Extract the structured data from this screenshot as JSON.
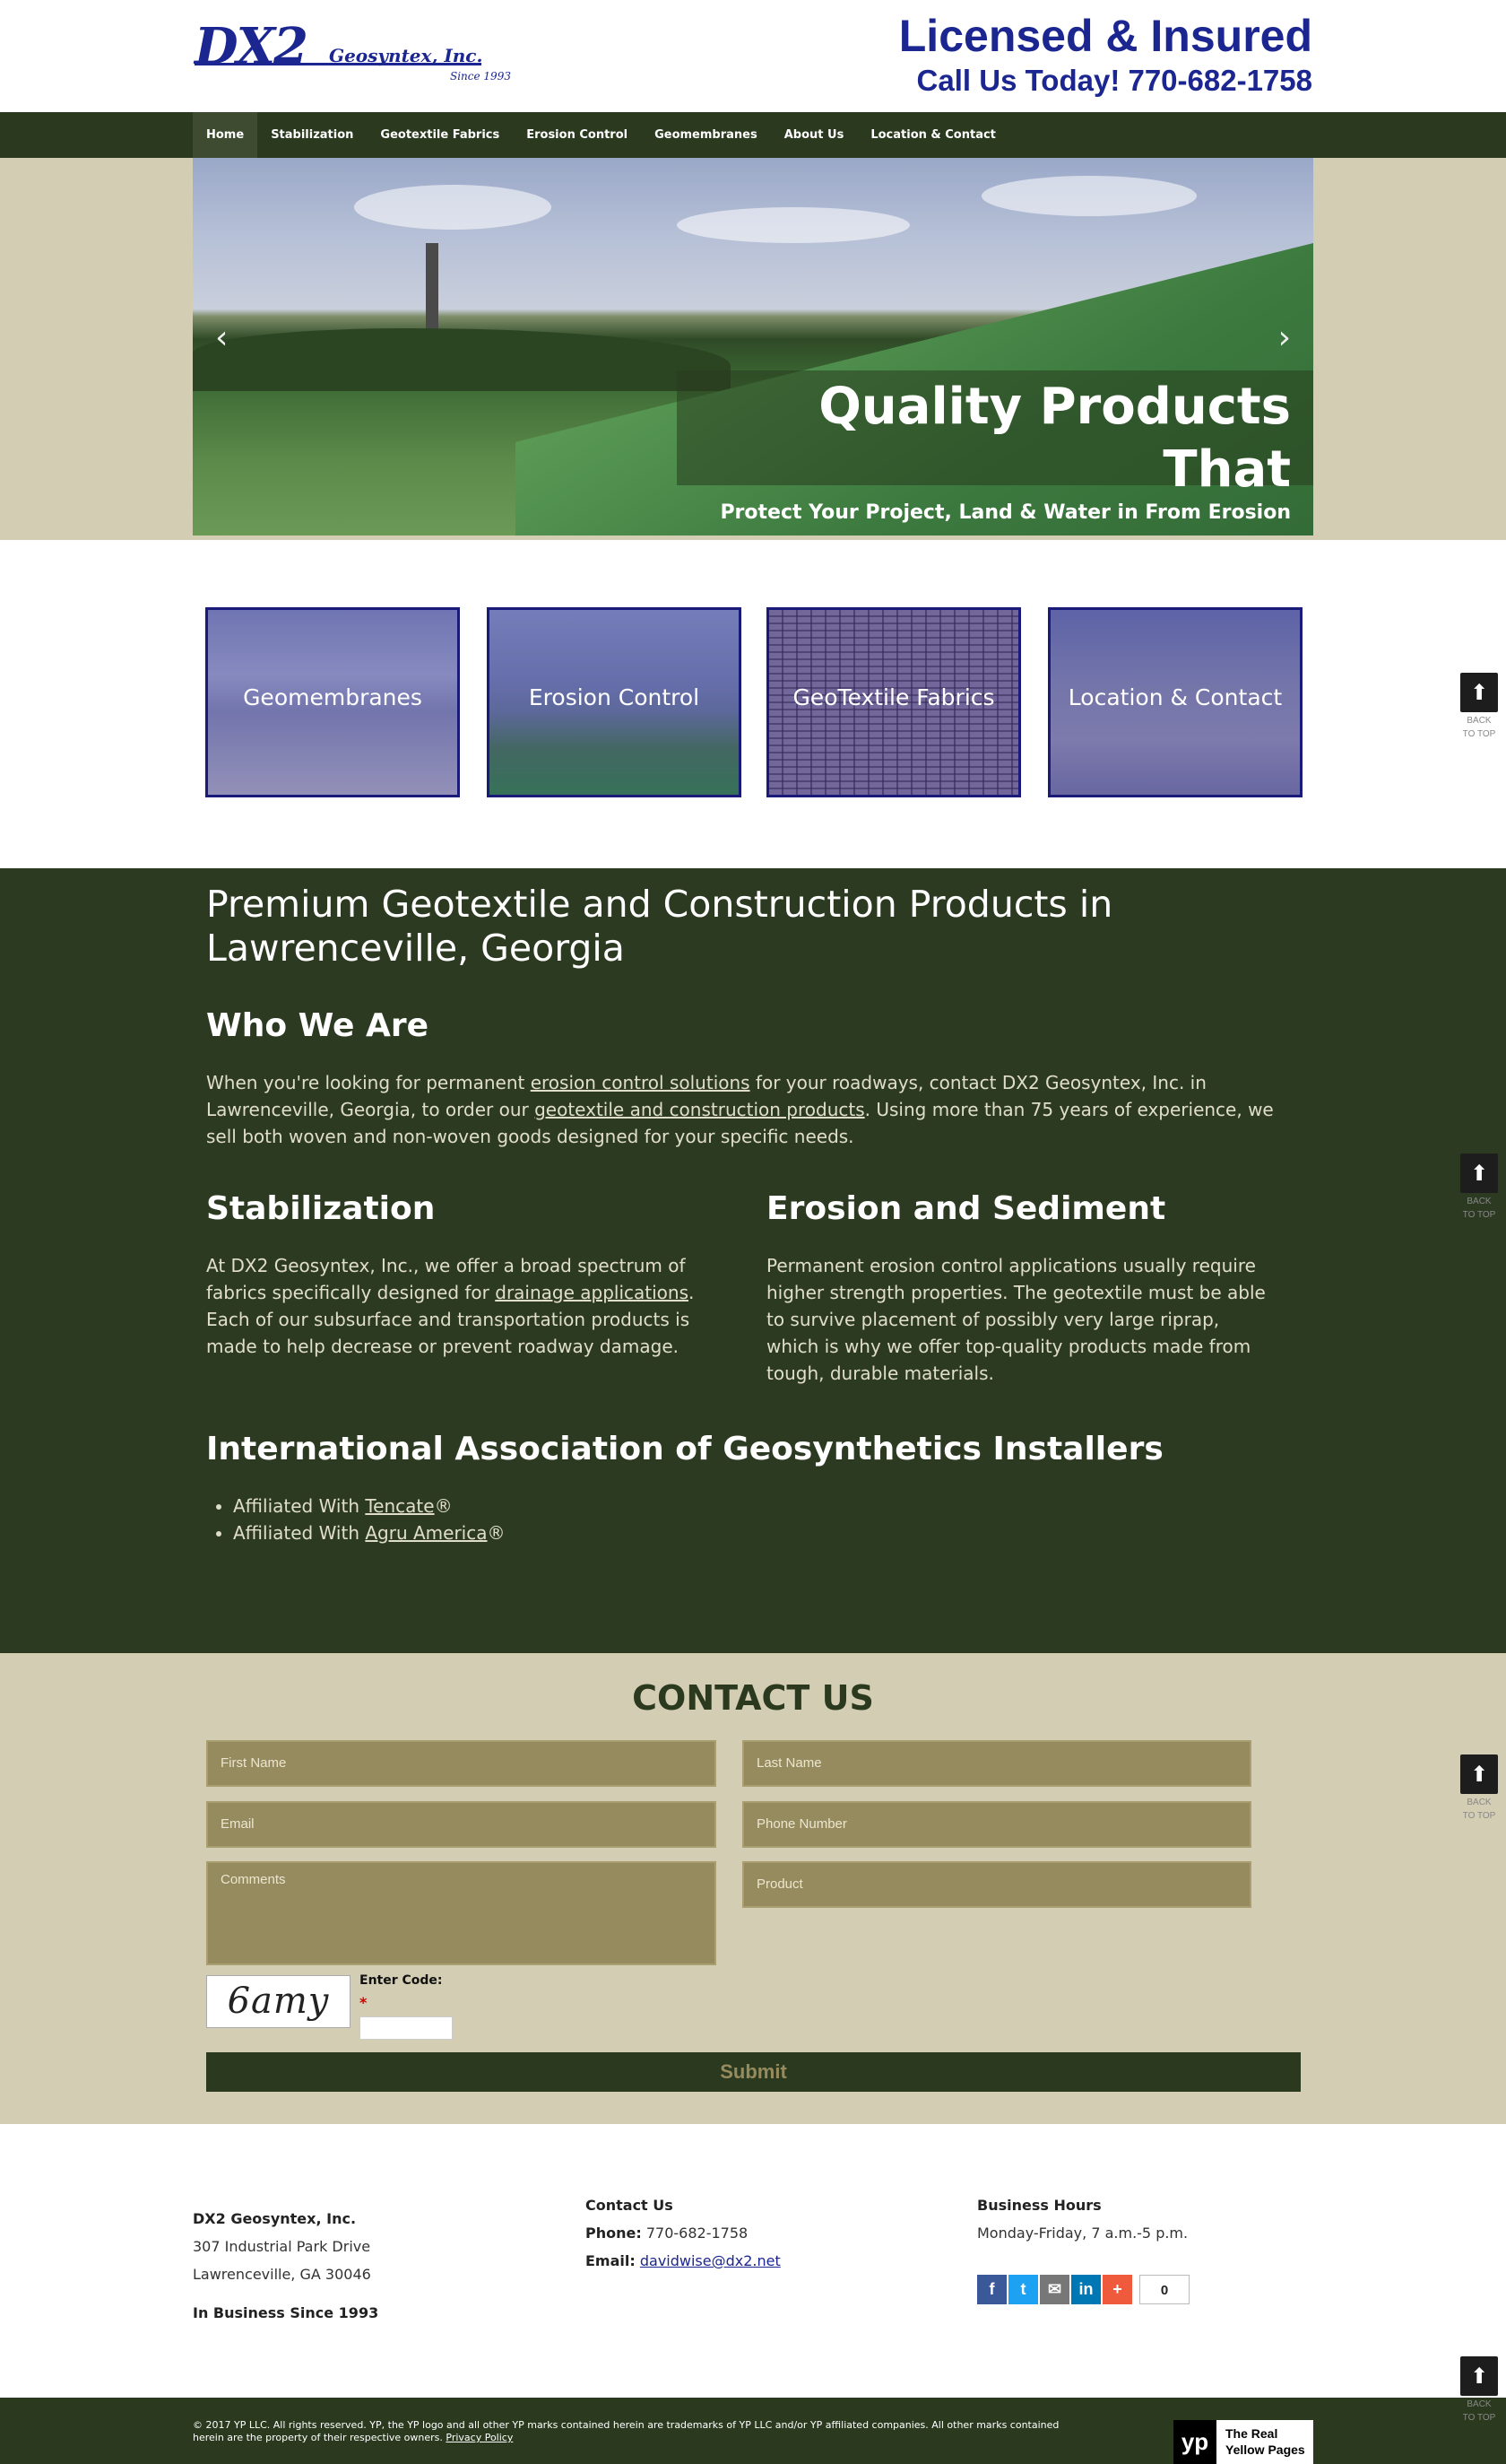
{
  "header": {
    "logo_main": "DX2",
    "logo_sub": "Geosyntex, Inc.",
    "logo_since": "Since 1993",
    "licensed": "Licensed & Insured",
    "call": "Call Us Today! 770-682-1758",
    "brand_color": "#1c2690"
  },
  "nav": {
    "items": [
      "Home",
      "Stabilization",
      "Geotextile Fabrics",
      "Erosion Control",
      "Geomembranes",
      "About Us",
      "Location & Contact"
    ],
    "active": "Home",
    "bg_color": "#2b3a1f"
  },
  "hero": {
    "title": "Quality Products That",
    "subtitle": "Protect Your Project, Land & Water in From Erosion",
    "prev_icon": "chevron-left-icon",
    "next_icon": "chevron-right-icon"
  },
  "tiles": [
    "Geomembranes",
    "Erosion Control",
    "GeoTextile Fabrics",
    "Location & Contact"
  ],
  "about": {
    "heading": "Premium Geotextile and Construction Products in Lawrenceville, Georgia",
    "who_title": "Who We Are",
    "who_text_1": "When you're looking for permanent ",
    "who_link_1": "erosion control solutions",
    "who_text_2": " for your roadways, contact DX2 Geosyntex, Inc. in Lawrenceville, Georgia, to order our ",
    "who_link_2": "geotextile and construction products",
    "who_text_3": ". Using more than 75 years of experience, we sell both woven and non-woven goods designed for your specific needs.",
    "stab_title": "Stabilization",
    "stab_text_1": "At DX2 Geosyntex, Inc., we offer a broad spectrum of fabrics specifically designed for ",
    "stab_link": "drainage applications",
    "stab_text_2": ". Each of our subsurface and transportation products is made to help decrease or prevent roadway damage.",
    "erosion_title": "Erosion and Sediment",
    "erosion_text": "Permanent erosion control applications usually require higher strength properties. The geotextile must be able to survive placement of possibly very large riprap, which is why we offer top-quality products made from tough, durable materials.",
    "assoc_title": "International Association of Geosynthetics Installers",
    "affiliated_prefix": "Affiliated With ",
    "aff_1": "Tencate",
    "aff_2": "Agru America",
    "reg": "®"
  },
  "contact": {
    "title": "CONTACT US",
    "first_name": "First Name",
    "last_name": "Last Name",
    "email": "Email",
    "phone": "Phone Number",
    "comments": "Comments",
    "product": "Product",
    "captcha_text": "6amy",
    "enter_code": "Enter Code:",
    "required_mark": "*",
    "submit": "Submit"
  },
  "footer": {
    "company": "DX2 Geosyntex, Inc.",
    "address1": "307 Industrial Park Drive",
    "address2": "Lawrenceville, GA 30046",
    "since": "In Business Since 1993",
    "contact_title": "Contact Us",
    "phone_label": "Phone:",
    "phone": "770-682-1758",
    "email_label": "Email:",
    "email": "davidwise@dx2.net",
    "hours_title": "Business Hours",
    "hours": "Monday-Friday, 7 a.m.-5 p.m.",
    "share_count": "0",
    "share_icons": [
      "facebook-icon",
      "twitter-icon",
      "email-icon",
      "linkedin-icon",
      "plus-icon"
    ]
  },
  "bottom": {
    "copyright": "© 2017 YP LLC. All rights reserved. YP, the YP logo and all other YP marks contained herein are trademarks of YP LLC and/or YP affiliated companies. All other marks contained herein are the property of their respective owners. ",
    "privacy": "Privacy Policy",
    "yp_logo": "yp",
    "yp_text_1": "The Real",
    "yp_text_2": "Yellow Pages"
  },
  "back_to_top": {
    "label_1": "BACK",
    "label_2": "TO TOP"
  }
}
